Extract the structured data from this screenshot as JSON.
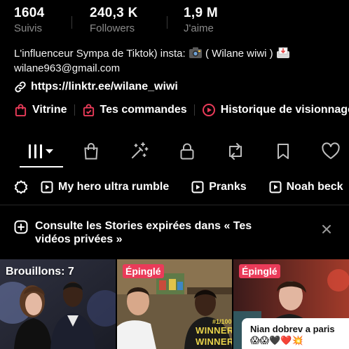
{
  "stats": [
    {
      "value": "1604",
      "label": "Suivis"
    },
    {
      "value": "240,3 K",
      "label": "Followers"
    },
    {
      "value": "1,9 M",
      "label": "J'aime"
    }
  ],
  "bio": {
    "line1_text": "L'influenceur Sympa de Tiktok) insta:",
    "line1_tail": "( Wilane wiwi )",
    "email": "wilane963@gmail.com",
    "link": "https://linktr.ee/wilane_wiwi"
  },
  "shop": {
    "vitrine": "Vitrine",
    "commandes": "Tes commandes",
    "historique": "Historique de visionnage"
  },
  "playlists": [
    "My hero ultra rumble",
    "Pranks",
    "Noah beck"
  ],
  "notice": {
    "line1": "Consulte les Stories expirées dans « Tes",
    "line2": "vidéos privées »"
  },
  "grid": {
    "drafts_label": "Brouillons: 7",
    "pinned_label_1": "Épinglé",
    "pinned_label_2": "Épinglé",
    "video2_jersey": "#1/100",
    "video2_shirt_1": "WINNER",
    "video2_shirt_2": "WINNER",
    "caption_line1": "Nian dobrev a paris",
    "caption_line2": "😱😱🖤❤️💥"
  },
  "colors": {
    "accent": "#ea3b59",
    "background": "#000000",
    "muted_text": "#8a8a8a"
  }
}
